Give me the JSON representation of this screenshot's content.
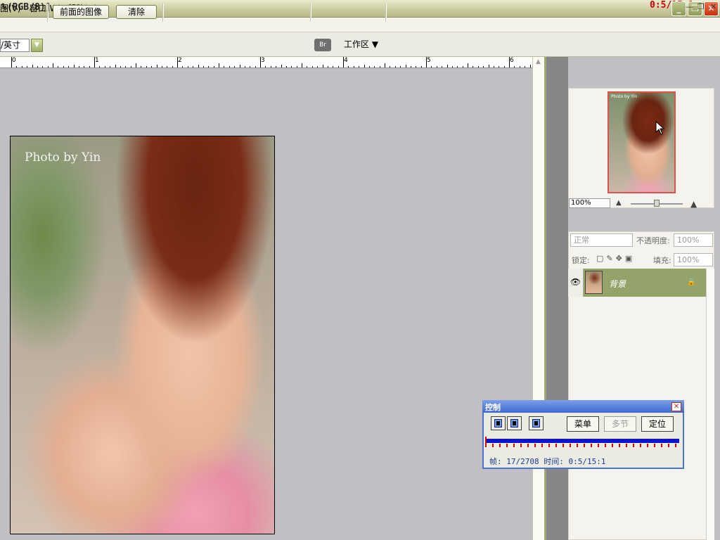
{
  "titlebar": {
    "title": "%(RGB/8)]",
    "timer": "0:5/15:1",
    "buttons": {
      "minimize": "_",
      "restore": "❐",
      "close": "✕"
    }
  },
  "menubar": {
    "items": [
      "图(V)",
      "窗口(W)",
      "帮助(H)"
    ],
    "mdi": {
      "minimize": "—",
      "restore": "❐",
      "close": "✕"
    }
  },
  "options": {
    "unit": "/英寸",
    "front_image_label": "前面的图像",
    "clear_label": "清除",
    "workspace_label": "工作区 ▼",
    "bridge_icon": "Br"
  },
  "ruler": {
    "ticks": [
      "0",
      "1",
      "2",
      "3",
      "4",
      "5",
      "6"
    ]
  },
  "photo": {
    "watermark": "Photo by Yin"
  },
  "navigator": {
    "zoom_value": "100%",
    "thumb_text": "Photo by Yin",
    "zoom_level": 0.5
  },
  "layers": {
    "blend_mode": "正常",
    "opacity_label": "不透明度:",
    "opacity_value": "100%",
    "lock_label": "锁定:",
    "fill_label": "填充:",
    "fill_value": "100%",
    "layer_name": "背景",
    "eye_icon": "👁"
  },
  "control": {
    "title": "控制",
    "close": "✕",
    "menu_label": "菜单",
    "section_label": "多节",
    "locate_label": "定位",
    "status": "帧: 17/2708 时间: 0:5/15:1",
    "progress": 1.0
  },
  "colors": {
    "accent_olive": "#94a36a",
    "progress_blue": "#0a14c8",
    "control_title": "#3f6ad0",
    "timer_red": "#d00000"
  }
}
